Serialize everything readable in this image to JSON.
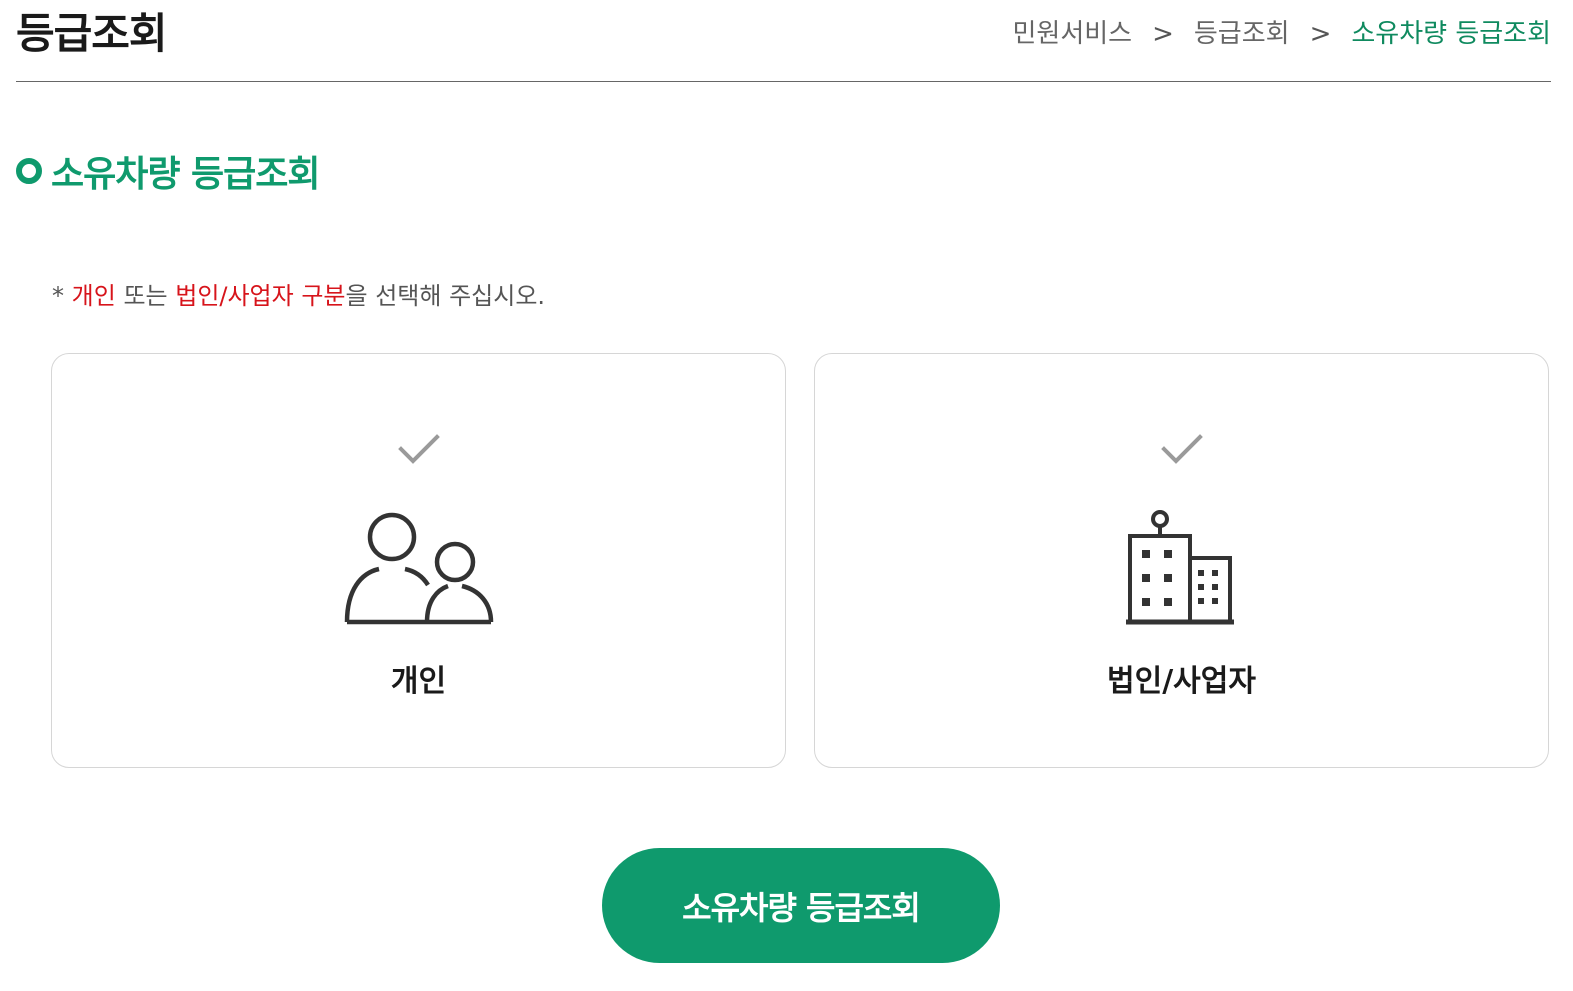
{
  "header": {
    "title": "등급조회",
    "breadcrumb": [
      "민원서비스",
      "등급조회",
      "소유차량 등급조회"
    ],
    "breadcrumb_separator": ">"
  },
  "section": {
    "title": "소유차량 등급조회"
  },
  "notice": {
    "prefix": "* ",
    "part1_red": "개인",
    "part2": " 또는 ",
    "part3_red": "법인/사업자 구분",
    "part4": "을 선택해 주십시오."
  },
  "options": [
    {
      "label": "개인",
      "icon": "people-icon",
      "check_icon": "checkmark-icon"
    },
    {
      "label": "법인/사업자",
      "icon": "building-icon",
      "check_icon": "checkmark-icon"
    }
  ],
  "submit": {
    "label": "소유차량 등급조회"
  },
  "colors": {
    "accent": "#0f9a6d",
    "breadcrumb_current": "#0f8a5f",
    "highlight_red": "#d7141b",
    "icon_gray": "#9a9a9a",
    "icon_dark": "#333333"
  }
}
